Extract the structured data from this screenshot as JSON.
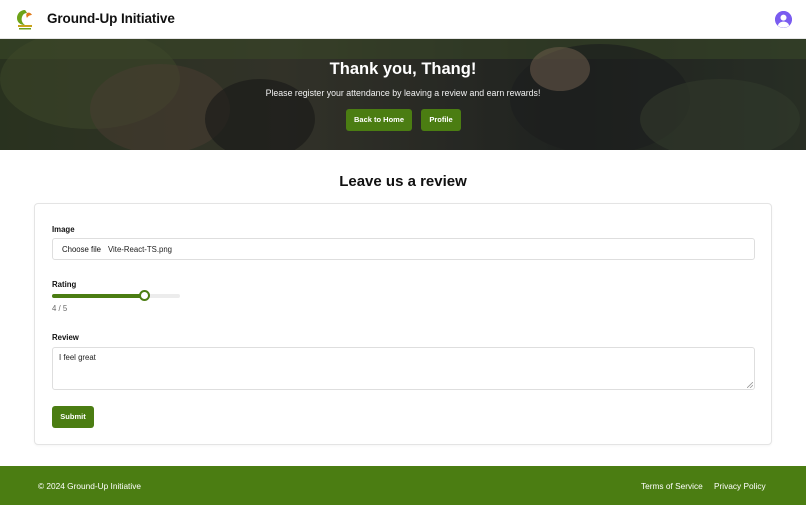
{
  "header": {
    "brand": "Ground-Up Initiative",
    "logo_icon": "gui-leaf-logo",
    "avatar_icon": "user-avatar-icon",
    "avatar_color": "#7a5cf0"
  },
  "hero": {
    "title": "Thank you, Thang!",
    "subtitle": "Please register your attendance by leaving a review and earn rewards!",
    "buttons": {
      "home": "Back to Home",
      "profile": "Profile"
    }
  },
  "review": {
    "title": "Leave us a review",
    "image_label": "Image",
    "file_button": "Choose file",
    "file_name": "Vite-React-TS.png",
    "rating_label": "Rating",
    "rating_value": 4,
    "rating_max": 5,
    "rating_text": "4 / 5",
    "review_label": "Review",
    "review_text": "I feel great",
    "submit": "Submit"
  },
  "footer": {
    "copyright": "© 2024 Ground-Up Initiative",
    "links": [
      "Terms of Service",
      "Privacy Policy"
    ]
  },
  "colors": {
    "brand_green": "#4b7d12",
    "footer_bg": "#4b7d12"
  }
}
